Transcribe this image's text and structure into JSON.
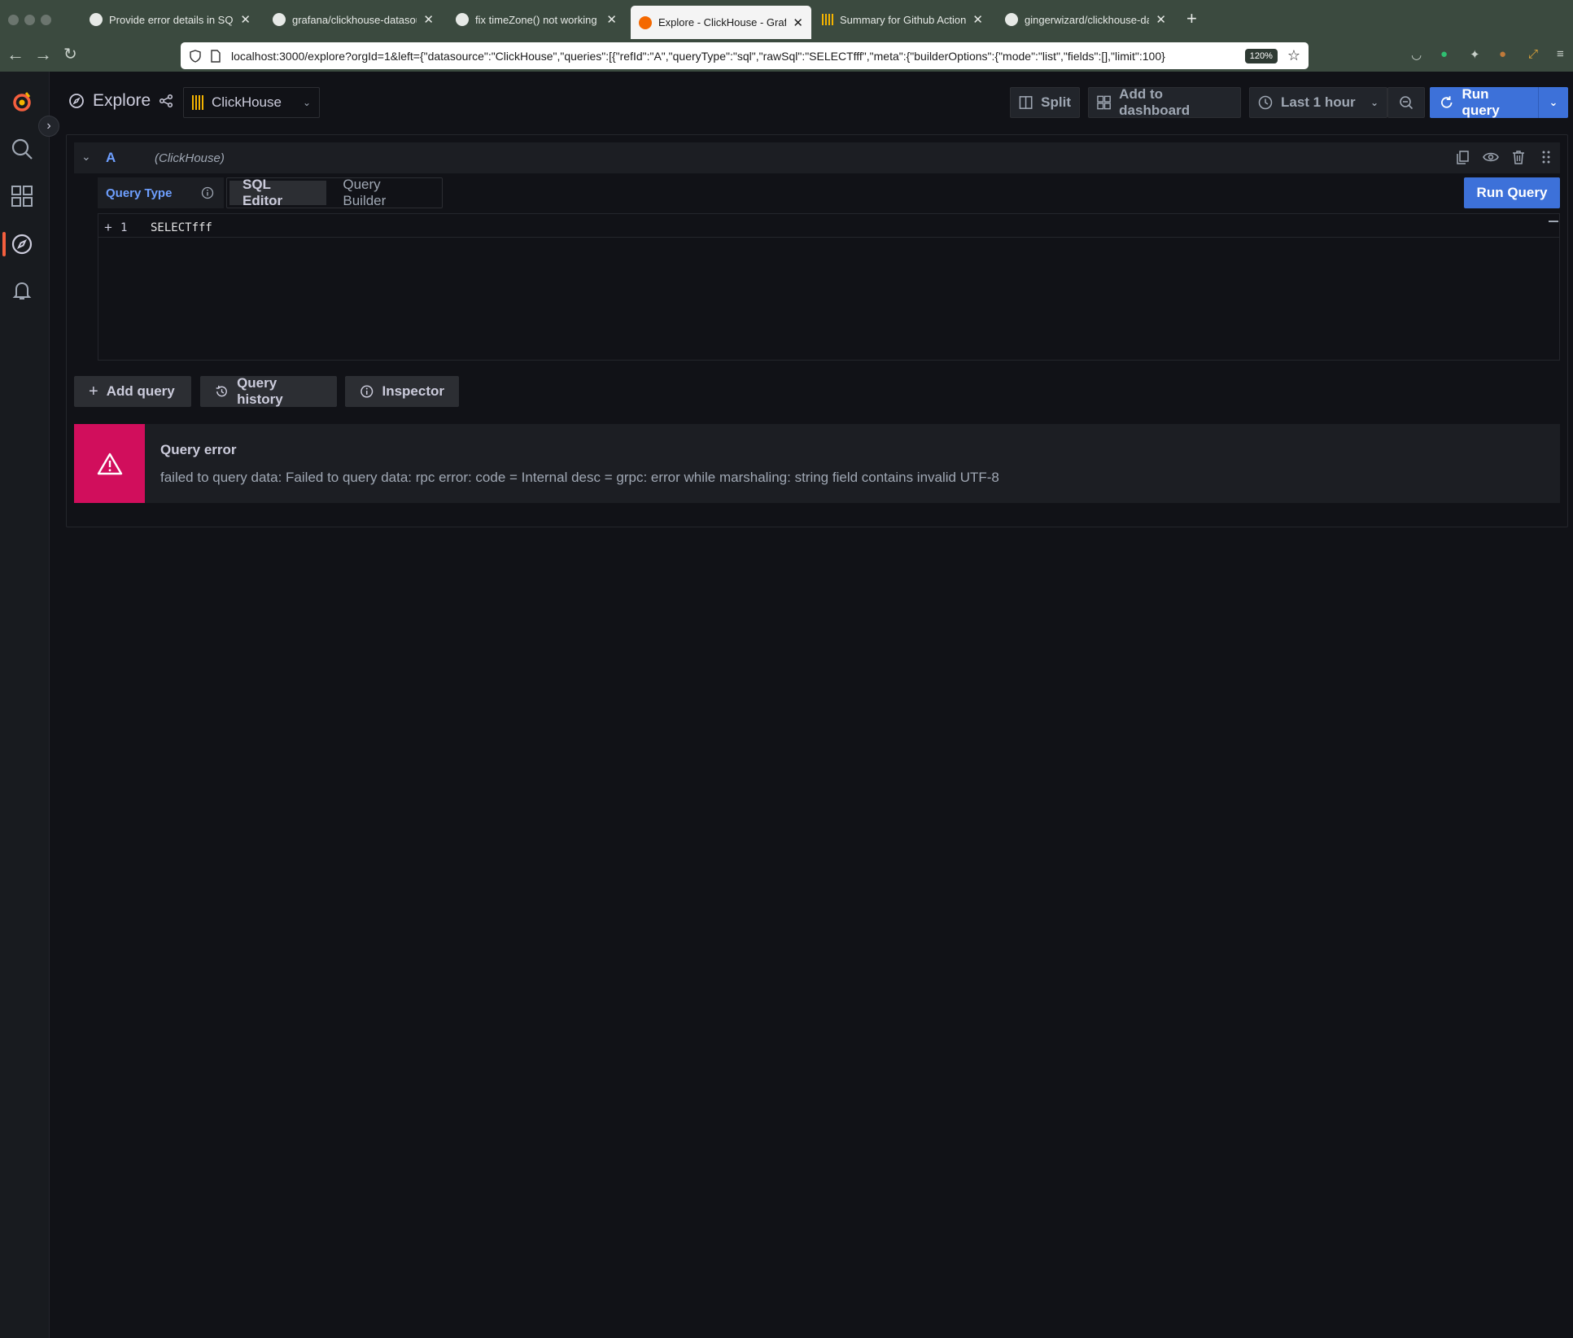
{
  "browser": {
    "tabs": [
      {
        "title": "Provide error details in SQL edit",
        "icon": "github-icon",
        "active": false
      },
      {
        "title": "grafana/clickhouse-datasource",
        "icon": "github-icon",
        "active": false
      },
      {
        "title": "fix timeZone() not working on v",
        "icon": "github-icon",
        "active": false
      },
      {
        "title": "Explore - ClickHouse - Grafana",
        "icon": "grafana-icon",
        "active": true
      },
      {
        "title": "Summary for Github Actions - C",
        "icon": "clickhouse-icon",
        "active": false
      },
      {
        "title": "gingerwizard/clickhouse-dataso",
        "icon": "github-icon",
        "active": false
      }
    ],
    "url": "localhost:3000/explore?orgId=1&left={\"datasource\":\"ClickHouse\",\"queries\":[{\"refId\":\"A\",\"queryType\":\"sql\",\"rawSql\":\"SELECTfff\",\"meta\":{\"builderOptions\":{\"mode\":\"list\",\"fields\":[],\"limit\":100}",
    "zoom": "120%"
  },
  "toolbar": {
    "title": "Explore",
    "datasource": "ClickHouse",
    "split_label": "Split",
    "add_dashboard_label": "Add to dashboard",
    "time_range": "Last 1 hour",
    "run_query_label": "Run query"
  },
  "query": {
    "ref_id": "A",
    "ds_name": "(ClickHouse)",
    "query_type_label": "Query Type",
    "editor_tab": "SQL Editor",
    "builder_tab": "Query Builder",
    "run_label": "Run Query",
    "line_number": "1",
    "code": "SELECTfff"
  },
  "actions": {
    "add_query": "Add query",
    "query_history": "Query history",
    "inspector": "Inspector"
  },
  "error": {
    "title": "Query error",
    "message": "failed to query data: Failed to query data: rpc error: code = Internal desc = grpc: error while marshaling: string field contains invalid UTF-8"
  },
  "colors": {
    "primary": "#3d71d9",
    "error": "#d10e5c",
    "grafana_orange": "#f55f3e",
    "ref_id_blue": "#6e9fff"
  }
}
